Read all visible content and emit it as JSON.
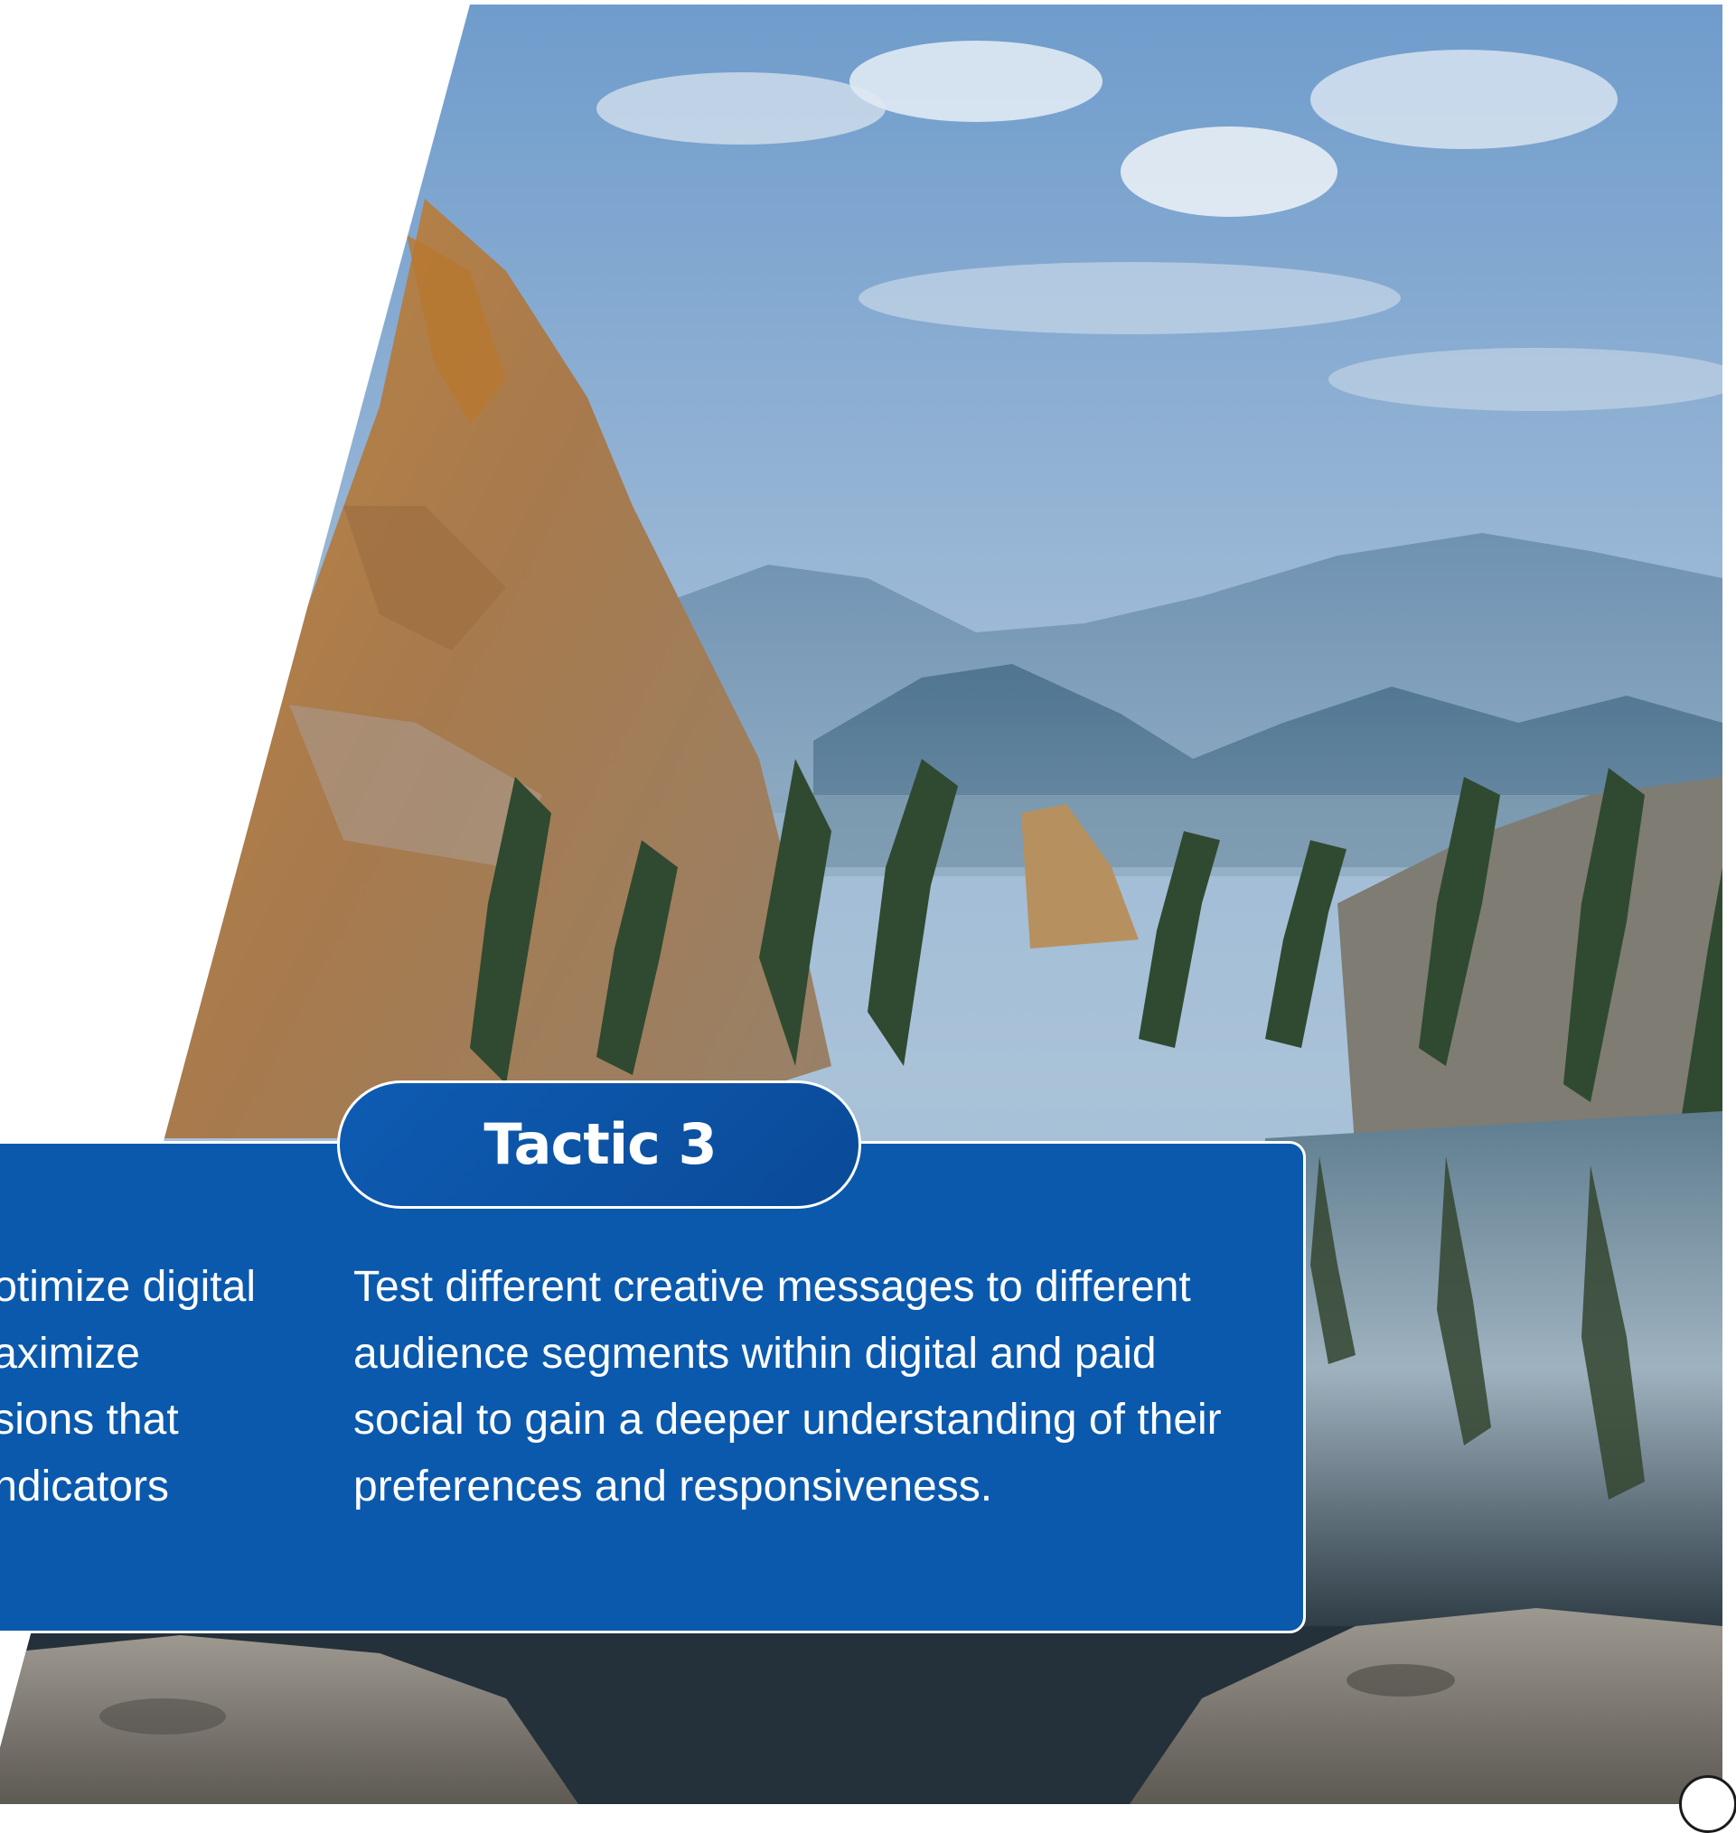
{
  "card": {
    "title": "Tactic 3",
    "body": "Test different creative messages to different audience segments within digital and paid social to gain a deeper understanding of their preferences and responsiveness."
  },
  "left_card_fragment": {
    "lines": [
      "otimize digital",
      "aximize",
      "sions that",
      "ndicators"
    ]
  },
  "photo": {
    "subject": "mountain-lake-landscape"
  },
  "colors": {
    "card_blue": "#0b59ad",
    "card_border": "#ffffff",
    "text": "#ffffff"
  }
}
